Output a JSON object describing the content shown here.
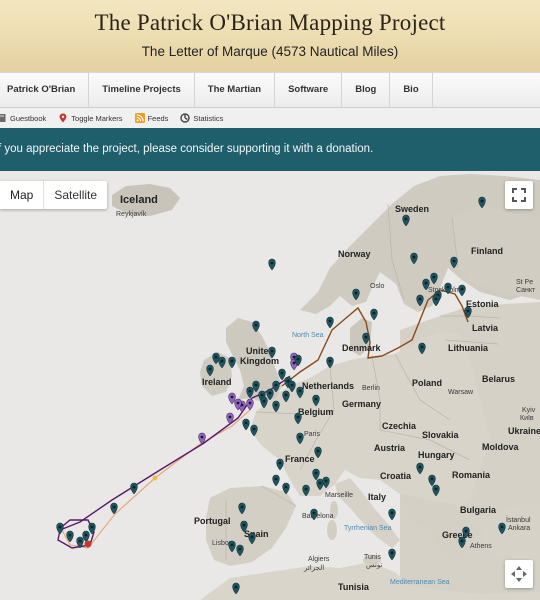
{
  "header": {
    "title": "The Patrick O'Brian Mapping Project",
    "subtitle": "The Letter of Marque (4573 Nautical Miles)"
  },
  "nav": {
    "items": [
      "Patrick O'Brian",
      "Timeline Projects",
      "The Martian",
      "Software",
      "Blog",
      "Bio"
    ]
  },
  "subnav": {
    "items": [
      {
        "label": "Guestbook",
        "icon": "guestbook-icon"
      },
      {
        "label": "Toggle Markers",
        "icon": "marker-pin-icon"
      },
      {
        "label": "Feeds",
        "icon": "rss-feed-icon"
      },
      {
        "label": "Statistics",
        "icon": "statistics-icon"
      }
    ]
  },
  "banner": {
    "text": "f you appreciate the project, please consider supporting it with a donation."
  },
  "map": {
    "type_buttons": [
      "Map",
      "Satellite"
    ],
    "selected_type": "Map",
    "labels": {
      "iceland": "Iceland",
      "reykjavik": "Reykjavík",
      "sweden": "Sweden",
      "finland": "Finland",
      "norway": "Norway",
      "oslo": "Oslo",
      "stockholm": "Stockholm",
      "estonia": "Estonia",
      "st_petersburg_1": "St Pe",
      "st_petersburg_2": "Санкт",
      "latvia": "Latvia",
      "north_sea": "North Sea",
      "denmark": "Denmark",
      "lithuania": "Lithuania",
      "united_kingdom_1": "United",
      "united_kingdom_2": "Kingdom",
      "ireland": "Ireland",
      "netherlands": "Netherlands",
      "berlin": "Berlin",
      "poland": "Poland",
      "belarus": "Belarus",
      "warsaw": "Warsaw",
      "belgium": "Belgium",
      "germany": "Germany",
      "kyiv_1": "Kyiv",
      "kyiv_2": "Київ",
      "paris": "Paris",
      "czechia": "Czechia",
      "slovakia": "Slovakia",
      "ukraine": "Ukraine",
      "france": "France",
      "austria": "Austria",
      "hungary": "Hungary",
      "moldova": "Moldova",
      "croatia": "Croatia",
      "romania": "Romania",
      "marseille": "Marseille",
      "italy": "Italy",
      "portugal": "Portugal",
      "barcelona": "Barcelona",
      "bulgaria": "Bulgaria",
      "istanbul": "İstanbul",
      "spain": "Spain",
      "lisbon": "Lisbon",
      "tyrrhenian_sea": "Tyrrhenian Sea",
      "greece": "Greece",
      "athens": "Athens",
      "ankara": "Ankara",
      "algiers_1": "Algiers",
      "algiers_2": "الجزائر",
      "tunis_1": "Tunis",
      "tunis_2": "تونس",
      "mediterranean_sea": "Mediterranean Sea",
      "tunisia": "Tunisia"
    },
    "route_colors": {
      "northern_route": "#8a4a18",
      "atlantic_route": "#5a1a6a",
      "atlantic_route_secondary": "#e6a87a"
    },
    "marker_colors": {
      "teal": "#1f5560",
      "purple": "#9a5fc4"
    }
  }
}
